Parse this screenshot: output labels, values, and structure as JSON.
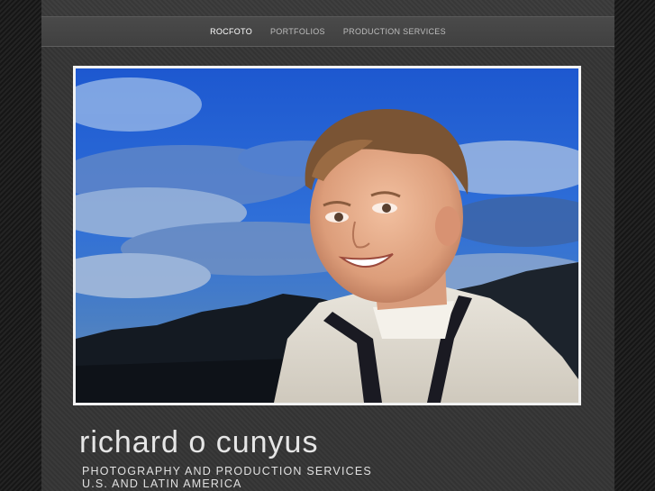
{
  "nav": {
    "items": [
      {
        "label": "ROCFOTO",
        "active": true
      },
      {
        "label": "PORTFOLIOS",
        "active": false
      },
      {
        "label": "PRODUCTION SERVICES",
        "active": false
      }
    ]
  },
  "hero": {
    "subject": "smiling boy in white knit sweater against blue cloudy sky"
  },
  "site": {
    "title": "richard o cunyus",
    "tagline_line1": "PHOTOGRAPHY AND PRODUCTION SERVICES",
    "tagline_line2": "U.S. AND LATIN AMERICA"
  },
  "colors": {
    "background": "#1a1a1a",
    "page": "#373737",
    "nav_active": "#ffffff",
    "nav_inactive": "#bdbdbd",
    "sky": "#1f5fd6"
  }
}
